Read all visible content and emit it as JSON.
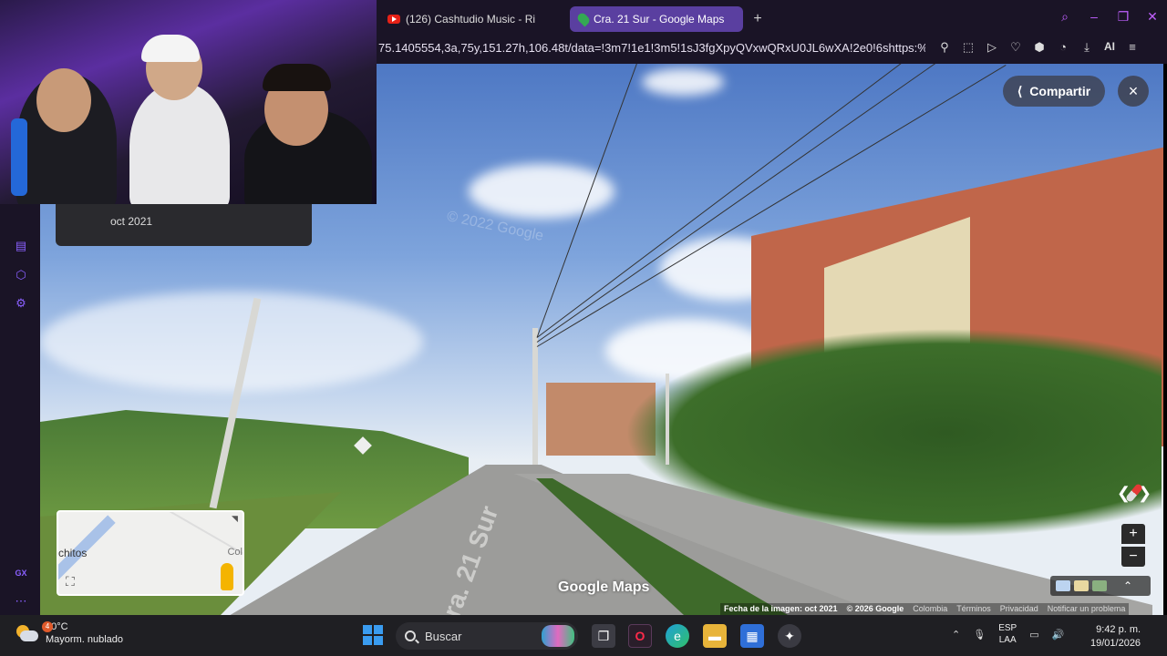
{
  "browser": {
    "tabs": [
      {
        "label": "(126) Cashtudio Music - Ri",
        "icon": "youtube-icon",
        "active": false
      },
      {
        "label": "Cra. 21 Sur - Google Maps",
        "icon": "google-maps-icon",
        "active": true
      }
    ],
    "new_tab_label": "+",
    "url": "75.1405554,3a,75y,151.27h,106.48t/data=!3m7!1e1!3m5!1sJ3fgXpyQVxwQRxU0JL6wXA!2e0!6shttps:%2",
    "ai_label": "AI"
  },
  "maps": {
    "share_label": "Compartir",
    "close_label": "×",
    "date_card": "oct 2021",
    "watermark": "© 2022 Google",
    "logo": "Google Maps",
    "road_text": "Cra. 21 Sur",
    "zoom_in": "+",
    "zoom_out": "−",
    "minimap": {
      "label_left": "chitos",
      "label_right": "Col"
    },
    "footer": {
      "image_date": "Fecha de la imagen: oct 2021",
      "copyright": "© 2026 Google",
      "country": "Colombia",
      "terms": "Términos",
      "privacy": "Privacidad",
      "report": "Notificar un problema"
    }
  },
  "taskbar": {
    "weather_temp": "20°C",
    "weather_desc": "Mayorm. nublado",
    "weather_badge": "4",
    "search_label": "Buscar",
    "lang_1": "ESP",
    "lang_2": "LAA",
    "time": "9:42 p. m.",
    "date": "19/01/2026"
  },
  "sidebar": {
    "bottom_label": "GX"
  },
  "colors": {
    "browser_bg": "#1a1426",
    "active_tab": "#5a3fa0",
    "accent": "#8a60ff"
  }
}
